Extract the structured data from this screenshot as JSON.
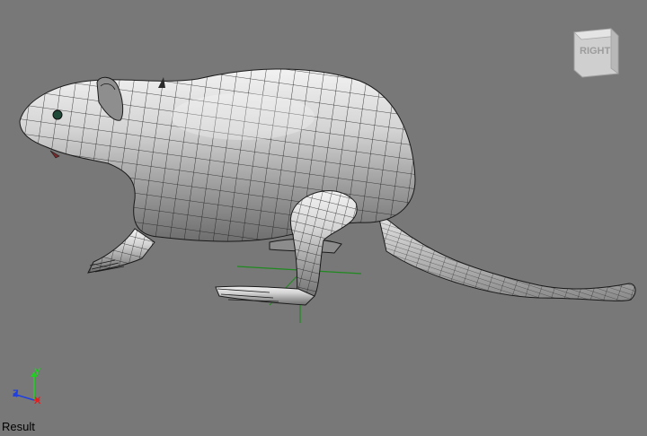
{
  "viewport": {
    "background_color": "#787878",
    "mesh_color": "#d9d9d9",
    "wire_color": "#1a1a1a",
    "pivot_color": "#1f8a1f"
  },
  "viewcube": {
    "face_label": "RIGHT",
    "icon": "view-cube-icon"
  },
  "axis_gizmo": {
    "x_label": "X",
    "y_label": "Y",
    "z_label": "Z",
    "x_color": "#e02020",
    "y_color": "#20d020",
    "z_color": "#2040e0"
  },
  "status": {
    "render_label": "Result"
  }
}
